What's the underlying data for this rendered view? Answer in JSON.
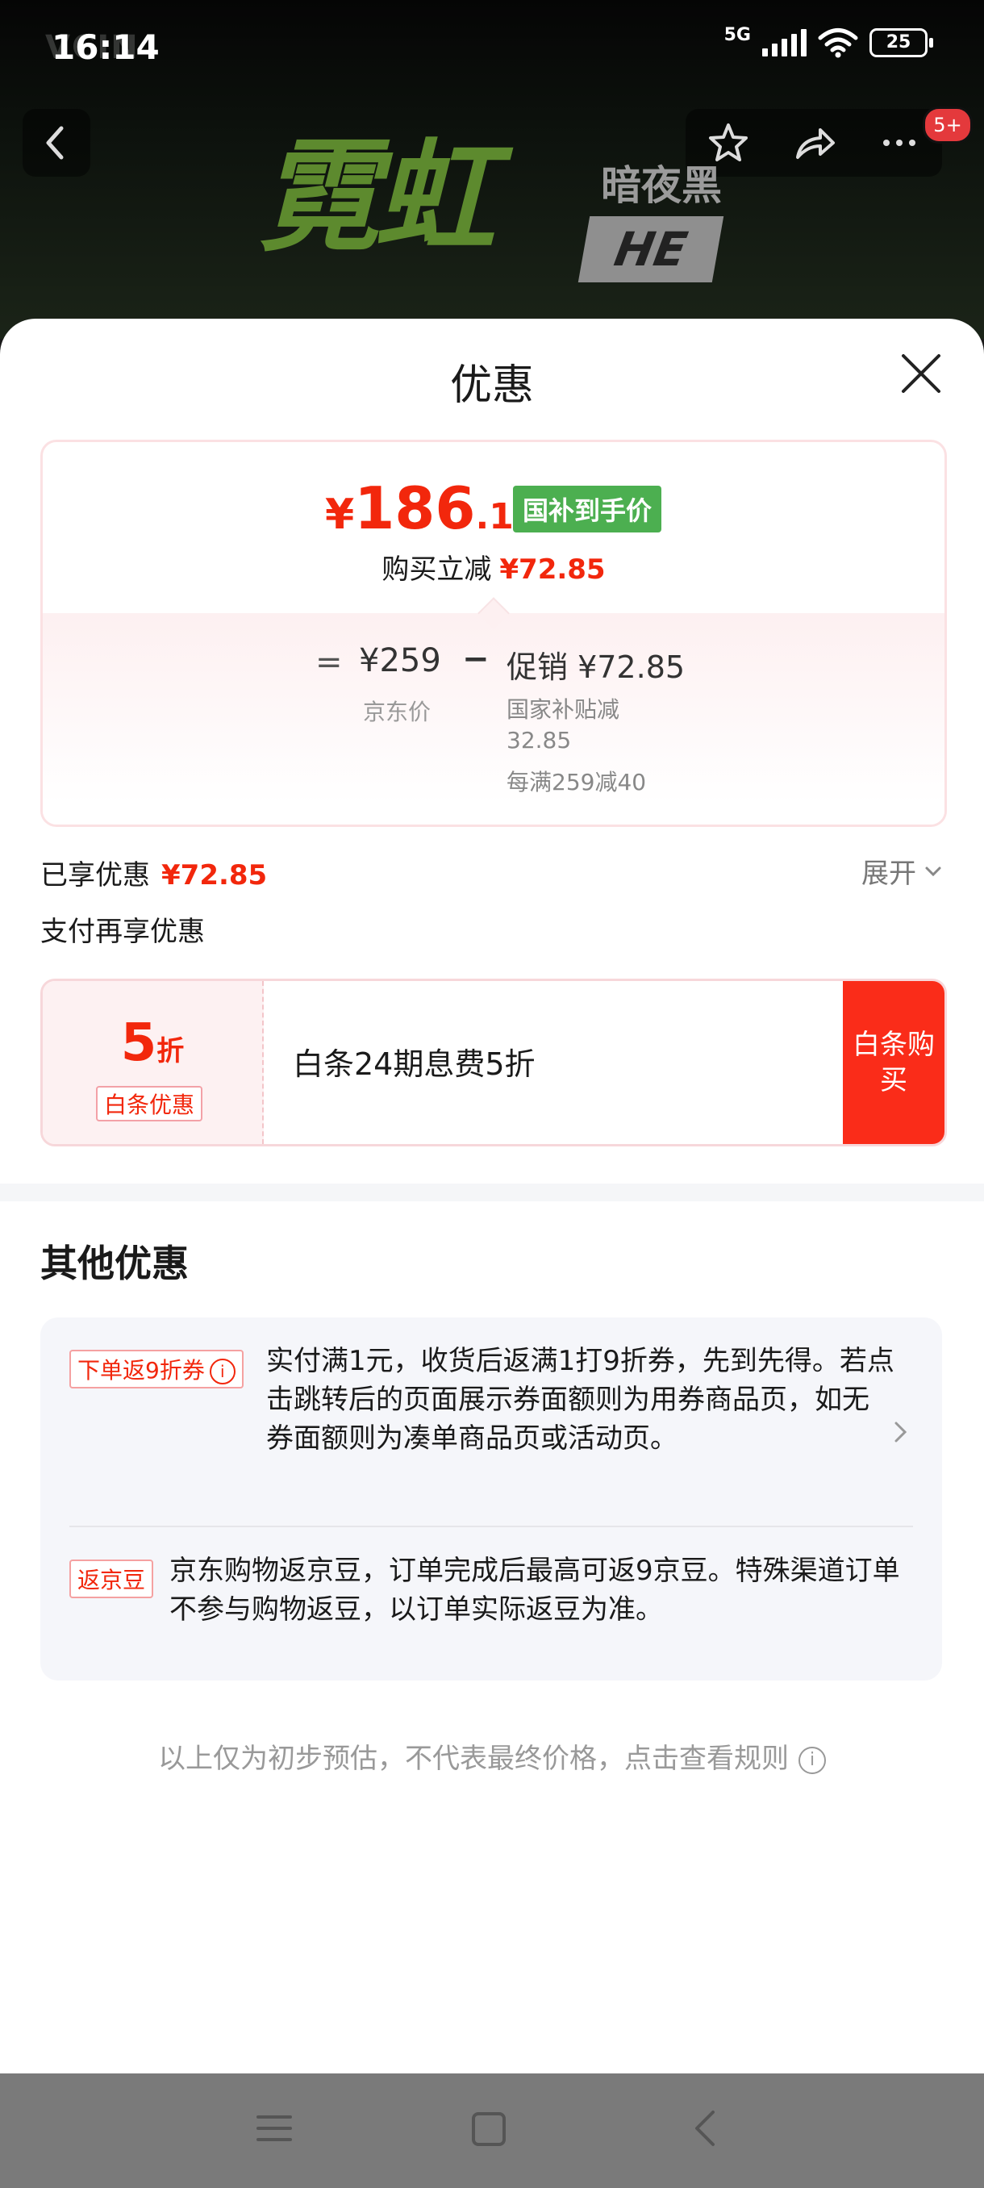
{
  "status_bar": {
    "time": "16:14",
    "network": "5G",
    "battery": "25",
    "brand_faint": "VCIN"
  },
  "header": {
    "banner_title": "霓虹",
    "banner_subtitle": "暗夜黑",
    "banner_tag": "HE",
    "notification_badge": "5+"
  },
  "sheet": {
    "title": "优惠",
    "price_card": {
      "currency": "¥",
      "price_int": "186",
      "price_dec": ".15",
      "badge": "国补到手价",
      "reduce_label": "购买立减",
      "reduce_amount": "¥72.85",
      "equals": "=",
      "jd_price": "¥259",
      "minus": "−",
      "promo": "促销 ¥72.85",
      "jd_price_label": "京东价",
      "promo_detail_1": "国家补贴减 32.85",
      "promo_detail_2": "每满259减40"
    },
    "enjoyed_label": "已享优惠",
    "enjoyed_amount": "¥72.85",
    "expand_label": "展开",
    "pay_more_label": "支付再享优惠",
    "baitiao": {
      "discount_num": "5",
      "discount_unit": "折",
      "tag": "白条优惠",
      "desc": "白条24期息费5折",
      "buy_button": "白条购买"
    },
    "other_title": "其他优惠",
    "other": [
      {
        "tag": "下单返9折券",
        "text": "实付满1元，收货后返满1打9折券，先到先得。若点击跳转后的页面展示券面额则为用券商品页，如无券面额则为凑单商品页或活动页。"
      },
      {
        "tag": "返京豆",
        "text": "京东购物返京豆，订单完成后最高可返9京豆。特殊渠道订单不参与购物返豆，以订单实际返豆为准。"
      }
    ],
    "footnote": "以上仅为初步预估，不代表最终价格，点击查看规则"
  },
  "colors": {
    "accent_red": "#f2270c",
    "badge_green": "#4caf50",
    "buy_red": "#fa2c19"
  }
}
